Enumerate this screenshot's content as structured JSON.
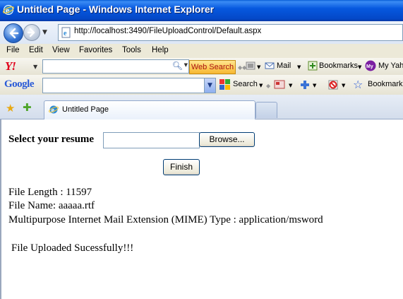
{
  "window": {
    "title": "Untitled Page - Windows Internet Explorer"
  },
  "address": {
    "url": "http://localhost:3490/FileUploadControl/Default.aspx"
  },
  "menu": {
    "items": [
      "File",
      "Edit",
      "View",
      "Favorites",
      "Tools",
      "Help"
    ]
  },
  "yahoo_toolbar": {
    "logo": "Y!",
    "search_value": "",
    "web_search_label": "Web Search",
    "mail_label": "Mail",
    "bookmarks_label": "Bookmarks",
    "my_yahoo_label": "My Yah"
  },
  "google_toolbar": {
    "logo": "Google",
    "search_value": "",
    "search_label": "Search",
    "bookmarks_label": "Bookmark"
  },
  "tabs": {
    "active_label": "Untitled Page"
  },
  "page": {
    "resume_label": "Select your resume",
    "file_input_value": "",
    "browse_label": "Browse...",
    "finish_label": "Finish",
    "file_length": "File Length : 11597",
    "file_name": "File Name: aaaaa.rtf",
    "mime_type": "Multipurpose Internet Mail Extension (MIME) Type : application/msword",
    "status": "File Uploaded Sucessfully!!!"
  },
  "colors": {
    "titlebar": "#0658df",
    "yahoo_red": "#e0001b",
    "web_search_bg": "#f7b731"
  }
}
